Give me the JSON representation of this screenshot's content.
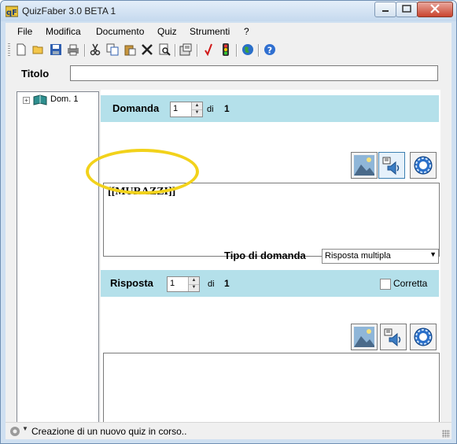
{
  "window": {
    "title": "QuizFaber 3.0 BETA 1"
  },
  "menu": [
    "File",
    "Modifica",
    "Documento",
    "Quiz",
    "Strumenti",
    "?"
  ],
  "toolbar": {
    "icons": [
      "new-icon",
      "open-icon",
      "save-icon",
      "print-icon",
      "cut-icon",
      "copy-icon",
      "paste-icon",
      "delete-icon",
      "preview-icon",
      "properties-icon",
      "check-icon",
      "traffic-light-icon",
      "globe-icon",
      "help-icon"
    ]
  },
  "titolo": {
    "label": "Titolo",
    "value": ""
  },
  "tree": {
    "items": [
      {
        "label": "Dom. 1"
      }
    ]
  },
  "domanda": {
    "label": "Domanda",
    "current": "1",
    "of_label": "di",
    "total": "1",
    "text": "[[MURAZZI]]",
    "media_buttons": [
      "image-icon",
      "audio-icon",
      "settings-icon"
    ]
  },
  "tipo": {
    "label": "Tipo di domanda",
    "selected": "Risposta multipla"
  },
  "risposta": {
    "label": "Risposta",
    "current": "1",
    "of_label": "di",
    "total": "1",
    "correct_label": "Corretta",
    "correct_checked": false,
    "text": "",
    "media_buttons": [
      "image-icon",
      "audio-icon",
      "settings-icon"
    ]
  },
  "status": {
    "text": "Creazione di un nuovo quiz in corso.."
  },
  "colors": {
    "band": "#b4e0ea",
    "highlight": "#f2d21b",
    "frame": "#cfe0f1"
  }
}
